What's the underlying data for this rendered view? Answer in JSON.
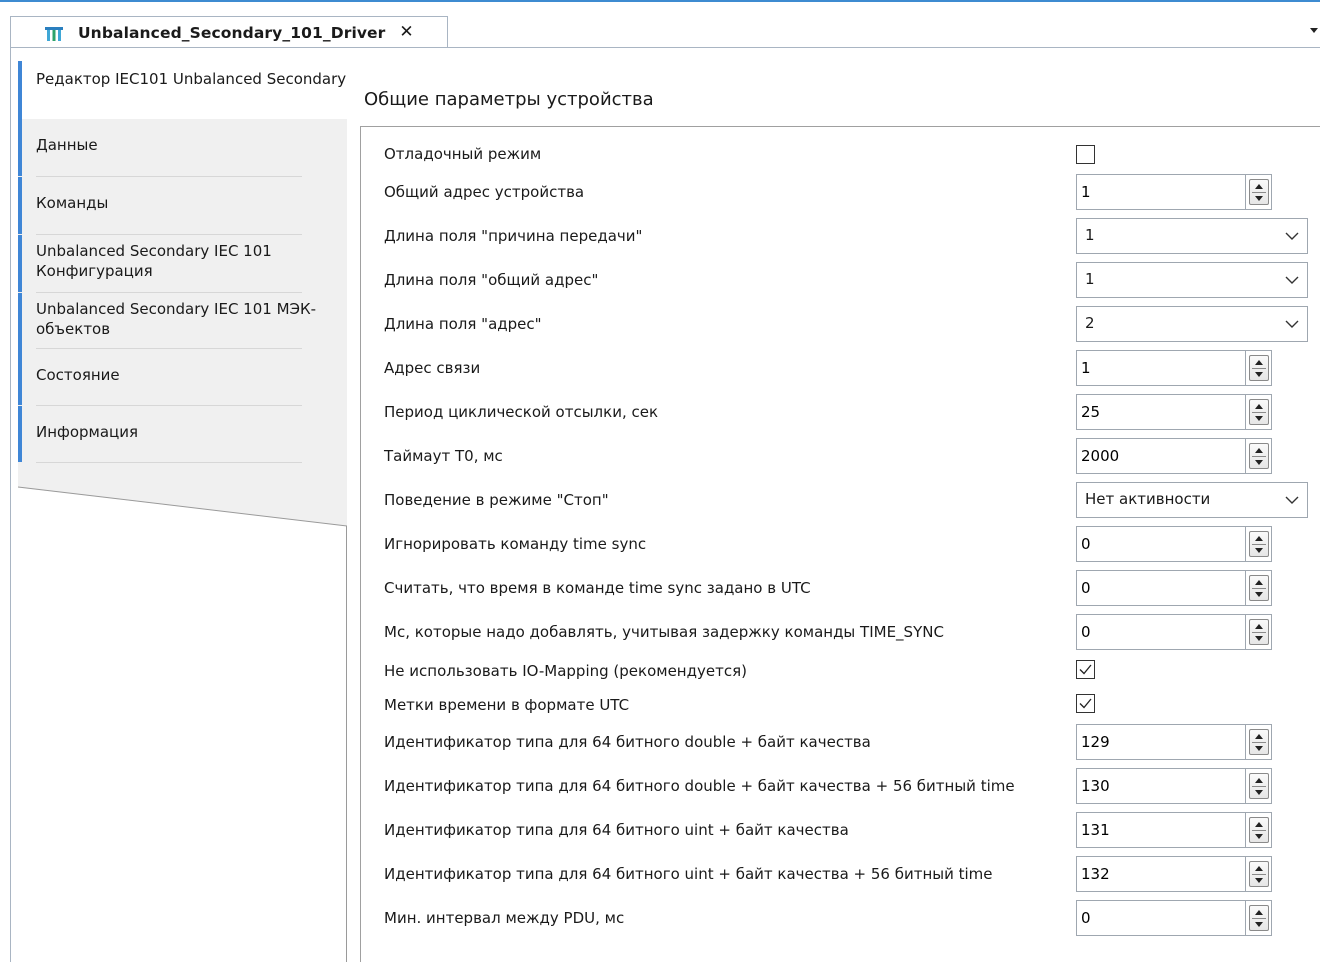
{
  "tab": {
    "title": "Unbalanced_Secondary_101_Driver",
    "close": "✕"
  },
  "sidebar": {
    "items": [
      {
        "label": "Редактор IEC101 Unbalanced Secondary"
      },
      {
        "label": "Данные"
      },
      {
        "label": "Команды"
      },
      {
        "label": "Unbalanced Secondary IEC 101 Конфигурация"
      },
      {
        "label": "Unbalanced Secondary IEC 101 МЭК-объектов"
      },
      {
        "label": "Состояние"
      },
      {
        "label": "Информация"
      }
    ]
  },
  "main": {
    "section_title": "Общие параметры устройства",
    "params": [
      {
        "label": "Отладочный режим",
        "type": "checkbox",
        "checked": false
      },
      {
        "label": "Общий адрес устройства",
        "type": "spin",
        "value": "1"
      },
      {
        "label": "Длина поля \"причина передачи\"",
        "type": "select",
        "value": "1"
      },
      {
        "label": "Длина поля \"общий адрес\"",
        "type": "select",
        "value": "1"
      },
      {
        "label": "Длина поля \"адрес\"",
        "type": "select",
        "value": "2"
      },
      {
        "label": "Адрес связи",
        "type": "spin",
        "value": "1"
      },
      {
        "label": "Период циклической отсылки, сек",
        "type": "spin",
        "value": "25"
      },
      {
        "label": "Таймаут T0, мс",
        "type": "spin",
        "value": "2000"
      },
      {
        "label": "Поведение в режиме \"Стоп\"",
        "type": "select",
        "value": "Нет активности"
      },
      {
        "label": "Игнорировать команду time sync",
        "type": "spin",
        "value": "0"
      },
      {
        "label": "Считать, что время в команде time sync задано в UTC",
        "type": "spin",
        "value": "0"
      },
      {
        "label": "Мс, которые надо добавлять, учитывая задержку команды TIME_SYNC",
        "type": "spin",
        "value": "0"
      },
      {
        "label": "Не использовать IO-Mapping (рекомендуется)",
        "type": "checkbox",
        "checked": true
      },
      {
        "label": "Метки времени в формате UTC",
        "type": "checkbox",
        "checked": true
      },
      {
        "label": "Идентификатор типа для 64 битного double + байт качества",
        "type": "spin",
        "value": "129"
      },
      {
        "label": "Идентификатор типа для 64 битного double + байт качества + 56 битный time",
        "type": "spin",
        "value": "130"
      },
      {
        "label": "Идентификатор типа для 64 битного uint + байт качества",
        "type": "spin",
        "value": "131"
      },
      {
        "label": "Идентификатор типа для 64 битного uint + байт качества + 56 битный time",
        "type": "spin",
        "value": "132"
      },
      {
        "label": "Мин. интервал между PDU, мс",
        "type": "spin",
        "value": "0"
      }
    ]
  }
}
